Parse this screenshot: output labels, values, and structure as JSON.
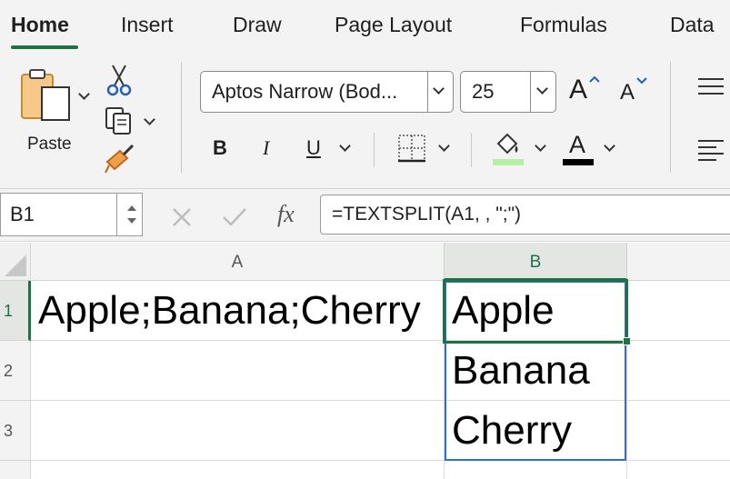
{
  "tabs": [
    {
      "label": "Home",
      "active": true
    },
    {
      "label": "Insert"
    },
    {
      "label": "Draw"
    },
    {
      "label": "Page Layout"
    },
    {
      "label": "Formulas"
    },
    {
      "label": "Data"
    }
  ],
  "ribbon": {
    "paste_label": "Paste",
    "font_name": "Aptos Narrow (Bod...",
    "font_size": "25",
    "bold_glyph": "B",
    "italic_glyph": "I",
    "underline_glyph": "U",
    "font_color_glyph": "A",
    "grow_glyph": "A",
    "shrink_glyph": "A",
    "fill_color": "#b7f0a4",
    "font_color": "#000000"
  },
  "formula_bar": {
    "name_box": "B1",
    "fx_label": "fx",
    "formula": "=TEXTSPLIT(A1, , \";\")"
  },
  "grid": {
    "columns": [
      "A",
      "B"
    ],
    "rows": [
      "1",
      "2",
      "3"
    ],
    "cells": {
      "A1": "Apple;Banana;Cherry",
      "B1": "Apple",
      "B2": "Banana",
      "B3": "Cherry"
    },
    "selected_cell": "B1"
  },
  "colors": {
    "accent": "#1e7145",
    "spill_border": "#2f6fd3"
  }
}
